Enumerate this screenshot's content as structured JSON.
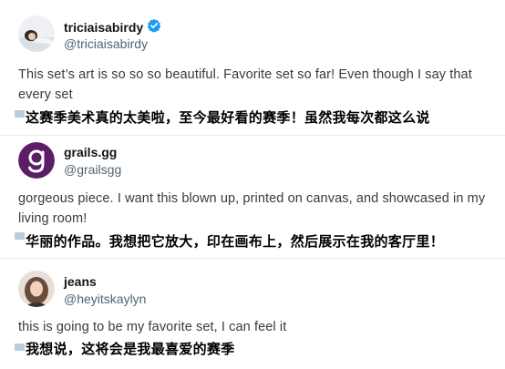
{
  "replies": [
    {
      "display_name": "triciaisabirdy",
      "handle": "@triciaisabirdy",
      "verified": true,
      "avatar_icon": "profile-photo-woman-lying",
      "text": "This set’s art is so so so beautiful. Favorite set so far! Even though I say that every set",
      "translation": "这赛季美术真的太美啦，至今最好看的赛季！虽然我每次都这么说",
      "verified_color": "#1d9bf0"
    },
    {
      "display_name": "grails.gg",
      "handle": "@grailsgg",
      "verified": false,
      "avatar_icon": "grails-logo-g",
      "avatar_color": "#5b1e66",
      "text": "gorgeous piece. I want this blown up, printed on canvas, and showcased in my living room!",
      "translation": "华丽的作品。我想把它放大，印在画布上，然后展示在我的客厅里！"
    },
    {
      "display_name": "jeans",
      "handle": "@heyitskaylyn",
      "verified": false,
      "avatar_icon": "profile-photo-woman",
      "text": "this is going to be my favorite set, I can feel it",
      "translation": "我想说，这将会是我最喜爱的赛季"
    }
  ]
}
